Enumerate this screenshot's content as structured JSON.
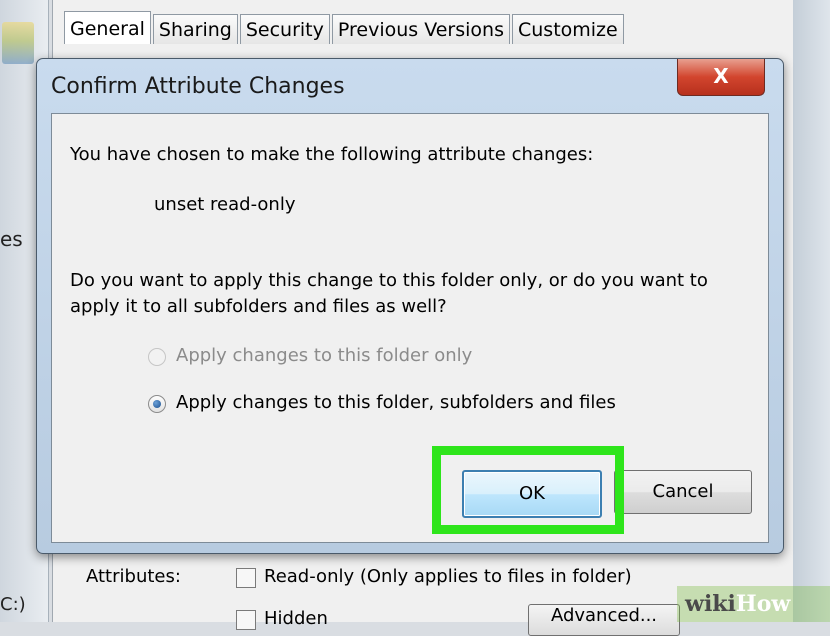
{
  "background": {
    "left_partial_text": "es",
    "left_partial_drive": "C:)",
    "tabs": [
      "General",
      "Sharing",
      "Security",
      "Previous Versions",
      "Customize"
    ],
    "attributes_label": "Attributes:",
    "readonly_label": "Read-only (Only applies to files in folder)",
    "hidden_label": "Hidden",
    "advanced_label": "Advanced..."
  },
  "dialog": {
    "title": "Confirm Attribute Changes",
    "close_symbol": "X",
    "message": "You have chosen to make the following attribute changes:",
    "change": "unset read-only",
    "question": "Do you want to apply this change to this folder only, or do you want to apply it to all subfolders and files as well?",
    "options": [
      {
        "label": "Apply changes to this folder only",
        "selected": false,
        "enabled": false
      },
      {
        "label": "Apply changes to this folder, subfolders and files",
        "selected": true,
        "enabled": true
      }
    ],
    "ok_label": "OK",
    "cancel_label": "Cancel"
  },
  "highlight_color": "#2ee51b",
  "watermark": {
    "part1": "wiki",
    "part2": "How"
  }
}
